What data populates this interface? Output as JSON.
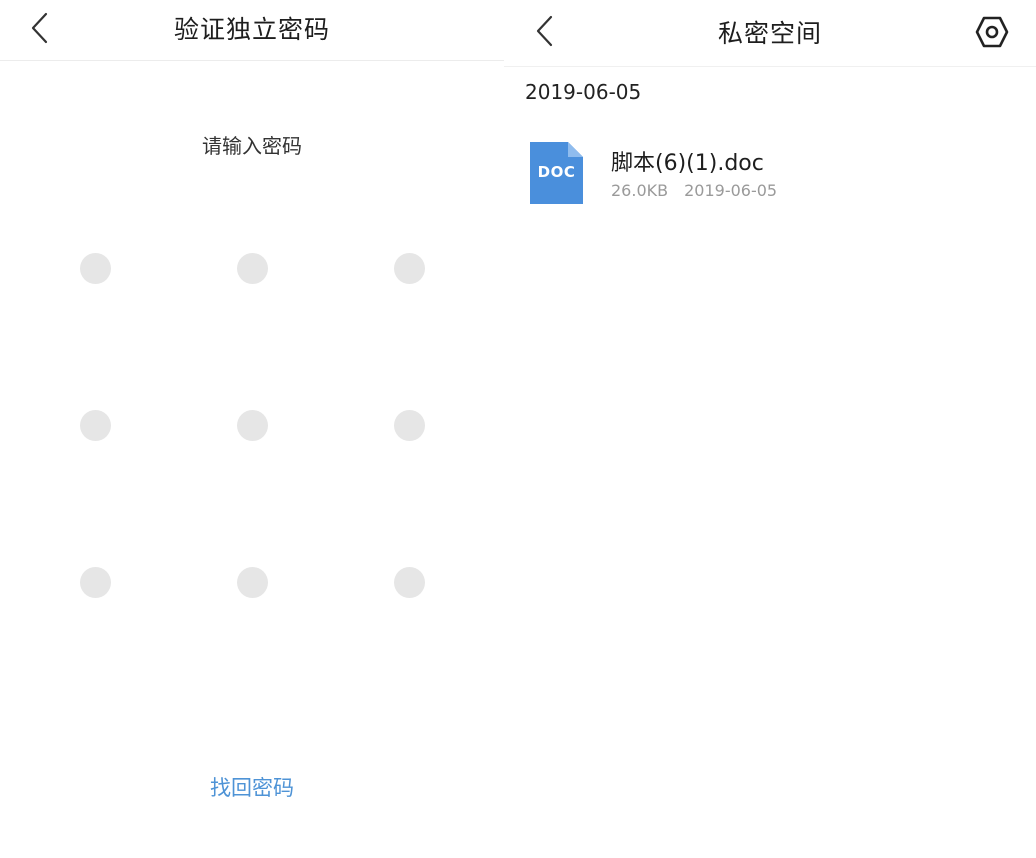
{
  "left_screen": {
    "title": "验证独立密码",
    "prompt": "请输入密码",
    "pattern_dots": [
      1,
      2,
      3,
      4,
      5,
      6,
      7,
      8,
      9
    ],
    "forgot_label": "找回密码",
    "accent_color": "#4e93d6"
  },
  "right_screen": {
    "title": "私密空间",
    "date_header": "2019-06-05",
    "files": [
      {
        "name": "脚本(6)(1).doc",
        "type_label": "DOC",
        "size": "26.0KB",
        "date": "2019-06-05",
        "icon": "doc-file-icon",
        "icon_color": "#4a8fdc"
      }
    ]
  },
  "icons": {
    "back": "chevron-left-icon",
    "settings": "hexagon-gear-icon"
  }
}
